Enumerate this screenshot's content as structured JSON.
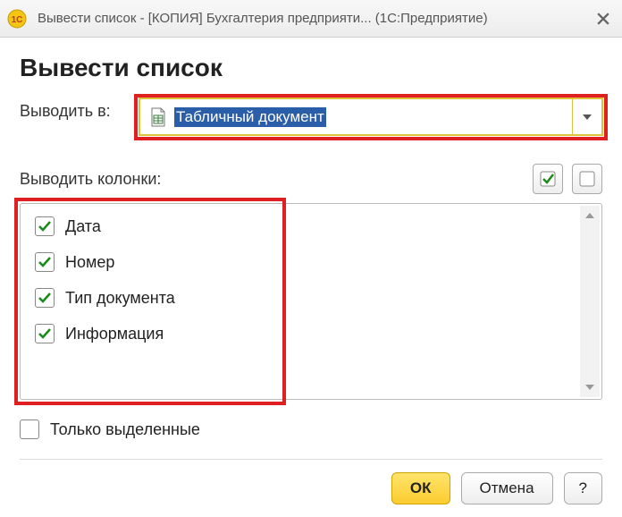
{
  "titlebar": {
    "text": "Вывести список - [КОПИЯ] Бухгалтерия предприяти...  (1С:Предприятие)"
  },
  "dialog": {
    "title": "Вывести список"
  },
  "output": {
    "label": "Выводить в:",
    "selected": "Табличный документ"
  },
  "columns": {
    "label": "Выводить колонки:",
    "items": [
      {
        "label": "Дата",
        "checked": true
      },
      {
        "label": "Номер",
        "checked": true
      },
      {
        "label": "Тип документа",
        "checked": true
      },
      {
        "label": "Информация",
        "checked": true
      }
    ]
  },
  "only_selected": {
    "label": "Только выделенные",
    "checked": false
  },
  "buttons": {
    "ok": "ОК",
    "cancel": "Отмена",
    "help": "?"
  }
}
